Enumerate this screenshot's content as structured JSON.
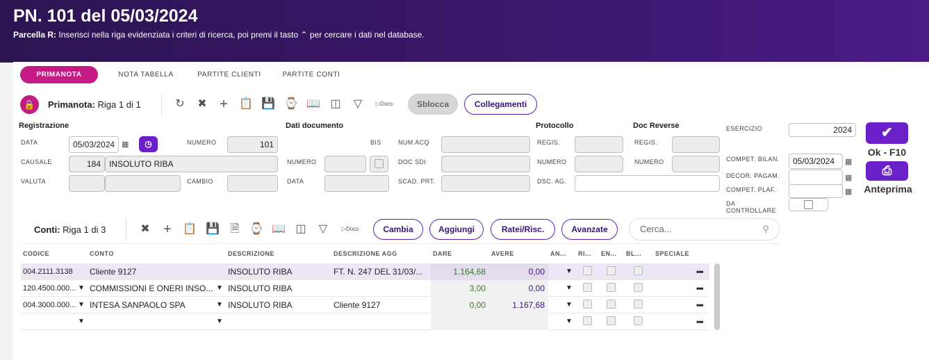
{
  "header": {
    "title": "PN. 101 del 05/03/2024",
    "sub_bold": "Parcella R:",
    "sub_text": " Inserisci nella riga evidenziata i criteri di ricerca, poi premi il tasto ",
    "sub_icon": "⌃",
    "sub_text2": " per cercare i dati nel database."
  },
  "tabs": [
    "PRIMANOTA",
    "NOTA TABELLA",
    "PARTITE CLIENTI",
    "PARTITE CONTI"
  ],
  "toolbar": {
    "label": "Primanota:",
    "riga": "Riga 1 di 1",
    "docs": "Docs",
    "sblocca": "Sblocca",
    "collegamenti": "Collegamenti"
  },
  "form": {
    "sec_registrazione": "Registrazione",
    "sec_dati_documento": "Dati documento",
    "sec_protocollo": "Protocollo",
    "sec_doc_reverse": "Doc Reverse",
    "lbl_data": "DATA",
    "data": "05/03/2024",
    "lbl_numero": "NUMERO",
    "numero": "101",
    "lbl_causale": "CAUSALE",
    "causale_code": "184",
    "causale_desc": "INSOLUTO RIBA",
    "lbl_valuta": "VALUTA",
    "lbl_cambio": "CAMBIO",
    "lbl_bis": "BIS",
    "lbl_num_acq": "NUM ACQ",
    "lbl_doc_numero": "NUMERO",
    "lbl_doc_sdi": "DOC SDI",
    "lbl_doc_data": "DATA",
    "lbl_scad_prt": "SCAD. PRT.",
    "lbl_regis": "REGIS.",
    "lbl_prot_numero": "NUMERO",
    "lbl_dsc_ag": "DSC. AG.",
    "lbl_rev_regis": "REGIS.",
    "lbl_rev_numero": "NUMERO",
    "lbl_esercizio": "ESERCIZIO",
    "esercizio": "2024",
    "lbl_compet_bilan": "COMPET. BILAN.",
    "compet_bilan": "05/03/2024",
    "lbl_decor_pagam": "DECOR. PAGAM.",
    "lbl_compet_plaf": "COMPET. PLAF.",
    "lbl_da_controllare_1": "DA",
    "lbl_da_controllare_2": "CONTROLLARE",
    "ok_label": "Ok - F10",
    "anteprima_label": "Anteprima"
  },
  "conti": {
    "label": "Conti:",
    "riga": "Riga 1 di 3",
    "docs": "Docs",
    "cambia": "Cambia",
    "aggiungi": "Aggiungi",
    "ratei": "Ratei/Risc.",
    "avanzate": "Avanzate",
    "search_placeholder": "Cerca..."
  },
  "grid": {
    "headers": [
      "CODICE",
      "CONTO",
      "DESCRIZIONE",
      "DESCRIZIONE AGG",
      "DARE",
      "AVERE",
      "AN...",
      "RI...",
      "EN...",
      "BL...",
      "SPECIALE"
    ],
    "rows": [
      {
        "codice": "004.2111.3138",
        "conto": "Cliente 9127",
        "descrizione": "INSOLUTO RIBA",
        "desc_agg": "FT. N. 247 DEL 31/03/...",
        "dare": "1.164,68",
        "avere": "0,00"
      },
      {
        "codice": "120.4500.000...",
        "conto": "COMMISSIONI E ONERI INSO...",
        "descrizione": "INSOLUTO RIBA",
        "desc_agg": "",
        "dare": "3,00",
        "avere": "0,00"
      },
      {
        "codice": "004.3000.000...",
        "conto": "INTESA SANPAOLO SPA",
        "descrizione": "INSOLUTO RIBA",
        "desc_agg": "Cliente 9127",
        "dare": "0,00",
        "avere": "1.167,68"
      },
      {
        "codice": "",
        "conto": "",
        "descrizione": "",
        "desc_agg": "",
        "dare": "",
        "avere": ""
      }
    ]
  }
}
